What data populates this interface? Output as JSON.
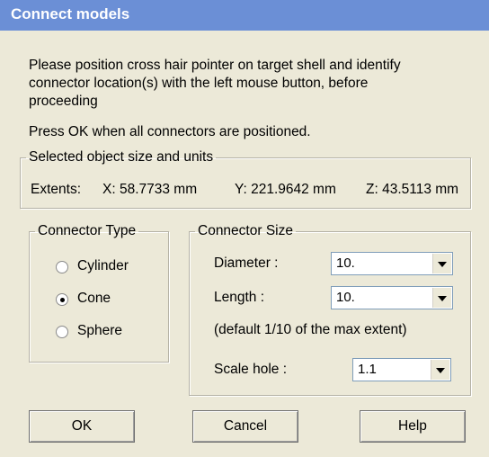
{
  "window": {
    "title": "Connect models"
  },
  "instructions": {
    "line1": "Please position cross hair pointer on target shell and identify",
    "line2": "connector location(s) with the left mouse button, before",
    "line3": "proceeding",
    "line4": "Press OK when all connectors are positioned."
  },
  "object_size": {
    "legend": "Selected object size and units",
    "extents_label": "Extents:",
    "x": "X: 58.7733 mm",
    "y": "Y: 221.9642 mm",
    "z": "Z: 43.5113 mm"
  },
  "connector_type": {
    "legend": "Connector Type",
    "options": [
      {
        "label": "Cylinder",
        "selected": false
      },
      {
        "label": "Cone",
        "selected": true
      },
      {
        "label": "Sphere",
        "selected": false
      }
    ]
  },
  "connector_size": {
    "legend": "Connector Size",
    "diameter_label": "Diameter :",
    "diameter_value": "10.",
    "length_label": "Length :",
    "length_value": "10.",
    "default_note": "(default 1/10 of the max extent)",
    "scale_label": "Scale hole :",
    "scale_value": "1.1"
  },
  "buttons": {
    "ok": "OK",
    "cancel": "Cancel",
    "help": "Help"
  }
}
